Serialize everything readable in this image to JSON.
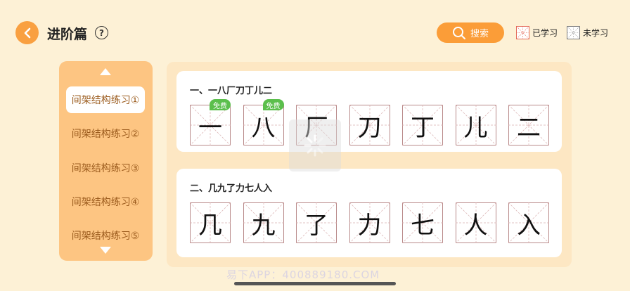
{
  "header": {
    "title": "进阶篇",
    "help_symbol": "?",
    "search_label": "搜索",
    "legend_learned": "已学习",
    "legend_unlearned": "未学习",
    "accent_color": "#fb9d38"
  },
  "sidebar": {
    "items": [
      {
        "label": "间架结构练习①",
        "active": true
      },
      {
        "label": "间架结构练习②",
        "active": false
      },
      {
        "label": "间架结构练习③",
        "active": false
      },
      {
        "label": "间架结构练习④",
        "active": false
      },
      {
        "label": "间架结构练习⑤",
        "active": false
      }
    ]
  },
  "lessons": [
    {
      "title": "一、一八厂刀丁儿二",
      "chars": [
        {
          "char": "一",
          "badge": "免费"
        },
        {
          "char": "八",
          "badge": "免费"
        },
        {
          "char": "厂",
          "badge": ""
        },
        {
          "char": "刀",
          "badge": ""
        },
        {
          "char": "丁",
          "badge": ""
        },
        {
          "char": "儿",
          "badge": ""
        },
        {
          "char": "二",
          "badge": ""
        }
      ]
    },
    {
      "title": "二、几九了力七人入",
      "chars": [
        {
          "char": "几",
          "badge": ""
        },
        {
          "char": "九",
          "badge": ""
        },
        {
          "char": "了",
          "badge": ""
        },
        {
          "char": "力",
          "badge": ""
        },
        {
          "char": "七",
          "badge": ""
        },
        {
          "char": "人",
          "badge": ""
        },
        {
          "char": "入",
          "badge": ""
        }
      ]
    }
  ],
  "watermark": "易下APP：400889180.COM"
}
